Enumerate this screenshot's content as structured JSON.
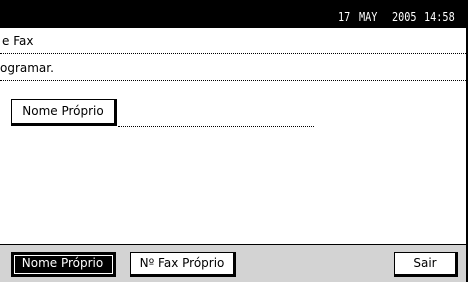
{
  "status_bar": {
    "day": "17",
    "month": "MAY",
    "year": "2005",
    "time": "14:58"
  },
  "screen": {
    "title": "e Fax",
    "instruction": "ogramar.",
    "field_button_label": "Nome Próprio"
  },
  "bottom_bar": {
    "tabs": [
      {
        "label": "Nome Próprio",
        "selected": true
      },
      {
        "label": "Nº Fax Próprio",
        "selected": false
      }
    ],
    "exit_label": "Sair"
  },
  "colors": {
    "bar": "#000000",
    "background": "#ffffff",
    "bottom_bar": "#e6e6e6"
  }
}
